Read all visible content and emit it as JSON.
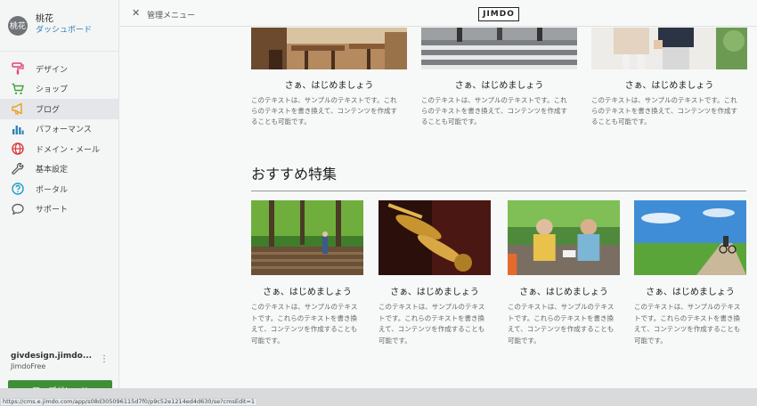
{
  "user": {
    "avatar": "桃花",
    "name": "桃花",
    "dashboard_link": "ダッシュボード"
  },
  "nav": [
    {
      "label": "デザイン",
      "icon": "paint-roller-icon",
      "color": "#e0457b"
    },
    {
      "label": "ショップ",
      "icon": "cart-icon",
      "color": "#46a33b"
    },
    {
      "label": "ブログ",
      "icon": "megaphone-icon",
      "color": "#e9a21c"
    },
    {
      "label": "パフォーマンス",
      "icon": "bar-chart-icon",
      "color": "#2d7fb8"
    },
    {
      "label": "ドメイン・メール",
      "icon": "globe-icon",
      "color": "#d93a3a"
    },
    {
      "label": "基本設定",
      "icon": "wrench-icon",
      "color": "#555555"
    },
    {
      "label": "ポータル",
      "icon": "help-circle-icon",
      "color": "#1a9fc9"
    },
    {
      "label": "サポート",
      "icon": "chat-bubble-icon",
      "color": "#555555"
    }
  ],
  "active_nav": "ブログ",
  "site": {
    "url": "givdesign.jimdo...",
    "plan": "JimdoFree",
    "upgrade_label": "アップグレード"
  },
  "topbar": {
    "close": "✕",
    "admin_menu": "管理メニュー",
    "logo": "JIMDO"
  },
  "top_cards": [
    {
      "title": "さぁ、はじめましょう",
      "text": "このテキストは、サンプルのテキストです。これらのテキストを書き換えて、コンテンツを作成することも可能です。"
    },
    {
      "title": "さぁ、はじめましょう",
      "text": "このテキストは、サンプルのテキストです。これらのテキストを書き換えて、コンテンツを作成することも可能です。"
    },
    {
      "title": "さぁ、はじめましょう",
      "text": "このテキストは、サンプルのテキストです。これらのテキストを書き換えて、コンテンツを作成することも可能です。"
    }
  ],
  "section_title": "おすすめ特集",
  "feature_cards": [
    {
      "title": "さぁ、はじめましょう",
      "text": "このテキストは、サンプルのテキストです。これらのテキストを書き換えて、コンテンツを作成することも可能です。"
    },
    {
      "title": "さぁ、はじめましょう",
      "text": "このテキストは、サンプルのテキストです。これらのテキストを書き換えて、コンテンツを作成することも可能です。"
    },
    {
      "title": "さぁ、はじめましょう",
      "text": "このテキストは、サンプルのテキストです。これらのテキストを書き換えて、コンテンツを作成することも可能です。"
    },
    {
      "title": "さぁ、はじめましょう",
      "text": "このテキストは、サンプルのテキストです。これらのテキストを書き換えて、コンテンツを作成することも可能です。"
    }
  ],
  "status_url": "https://cms.e.jimdo.com/app/s08d305096115d7f0/p9c52e1214ed4d630/se?cmsEdit=1"
}
